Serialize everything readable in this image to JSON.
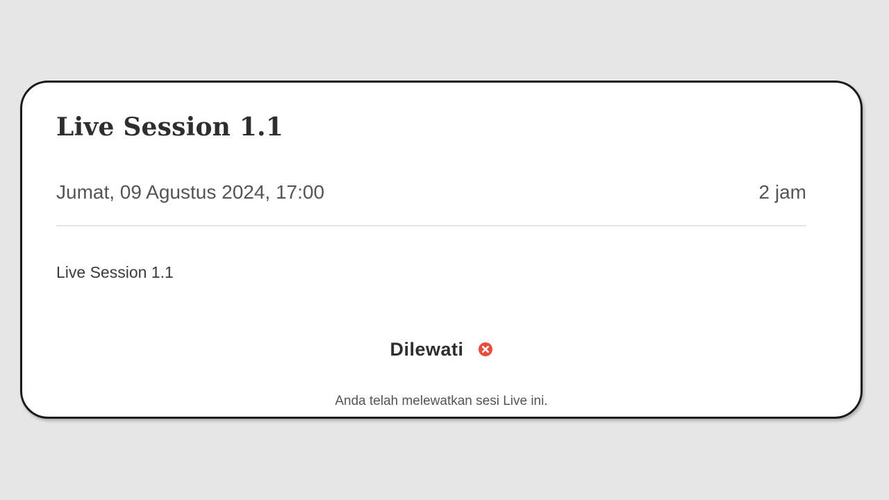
{
  "session": {
    "title": "Live Session 1.1",
    "datetime": "Jumat, 09 Agustus 2024, 17:00",
    "duration": "2 jam",
    "description": "Live Session 1.1"
  },
  "status": {
    "label": "Dilewati",
    "icon": "x-circle-icon",
    "icon_color": "#e74c3c",
    "note": "Anda telah melewatkan sesi Live ini."
  },
  "colors": {
    "background": "#e6e6e6",
    "card": "#ffffff",
    "border": "#1a1a1a",
    "text": "#333333"
  }
}
